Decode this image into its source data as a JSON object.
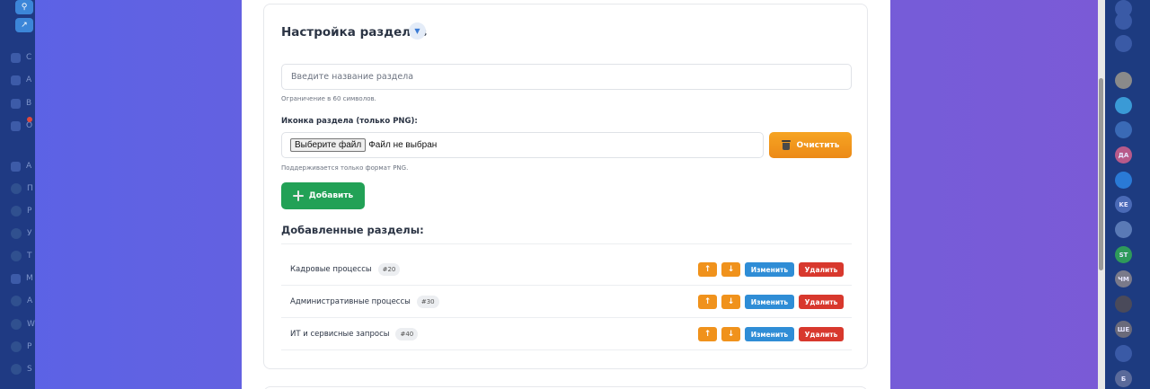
{
  "left_sidebar": {
    "items": [
      {
        "text": "С"
      },
      {
        "text": "А"
      },
      {
        "text": "В"
      },
      {
        "text": "О"
      },
      {
        "text": "А"
      },
      {
        "text": "П"
      },
      {
        "text": "Р"
      },
      {
        "text": "У"
      },
      {
        "text": "Т"
      },
      {
        "text": "М"
      },
      {
        "text": "А"
      },
      {
        "text": "W"
      },
      {
        "text": "Р"
      },
      {
        "text": "S"
      }
    ]
  },
  "right_sidebar": {
    "avatars": [
      "",
      "",
      "",
      "",
      "",
      "",
      "ДА",
      "",
      "KE",
      "",
      "ST",
      "ЧМ",
      "",
      "ШЕ",
      "",
      "Б"
    ]
  },
  "section_settings": {
    "title": "Настройка разделов",
    "toggle_icon": "▼",
    "name_placeholder": "Введите название раздела",
    "name_value": "",
    "name_hint": "Ограничение в 60 символов.",
    "icon_label": "Иконка раздела (только PNG):",
    "file_button_label": "Выберите файл",
    "file_status": "Файл не выбран",
    "clear_button_label": "Очистить",
    "format_hint": "Поддерживается только формат PNG.",
    "add_button_label": "Добавить",
    "added_title": "Добавленные разделы:",
    "sections": [
      {
        "name": "Кадровые процессы",
        "id": "#20"
      },
      {
        "name": "Административные процессы",
        "id": "#30"
      },
      {
        "name": "ИТ и сервисные запросы",
        "id": "#40"
      }
    ],
    "actions": {
      "up": "↑",
      "down": "↓",
      "edit": "Изменить",
      "delete": "Удалить"
    }
  },
  "colors": {
    "accent_blue": "#2f8dd6",
    "orange": "#f0921c",
    "green": "#22a156",
    "red": "#d8382d"
  }
}
